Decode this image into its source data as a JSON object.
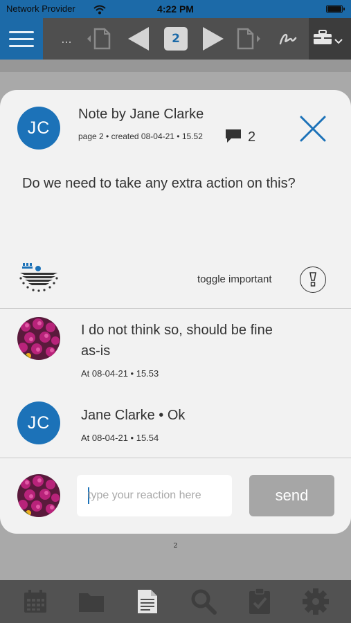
{
  "status_bar": {
    "carrier": "Network Provider",
    "time": "4:22 PM"
  },
  "toolbar": {
    "ellipsis": "...",
    "current_page": "2"
  },
  "note": {
    "author_initials": "JC",
    "title": "Note by Jane Clarke",
    "meta": "page 2 • created 08-04-21 • 15.52",
    "comment_count": "2",
    "body": "Do we need to take any extra action on this?",
    "toggle_label": "toggle important"
  },
  "replies": [
    {
      "text": "I do not think so, should be fine as-is",
      "meta": "At 08-04-21 • 15.53"
    },
    {
      "initials": "JC",
      "text": "Jane Clarke • Ok",
      "meta": "At 08-04-21 • 15.54"
    }
  ],
  "reaction": {
    "placeholder": "type your reaction here",
    "send_label": "send"
  },
  "page_label": "2",
  "colors": {
    "brand_blue": "#1c72b8",
    "toolbar_gray": "#4f4f4f",
    "card_bg": "#f2f2f2",
    "send_disabled": "#a6a6a6"
  },
  "tabbar": {
    "icons": [
      "calendar-icon",
      "folder-icon",
      "document-icon",
      "search-icon",
      "clipboard-check-icon",
      "gear-icon"
    ],
    "active": "document-icon"
  }
}
